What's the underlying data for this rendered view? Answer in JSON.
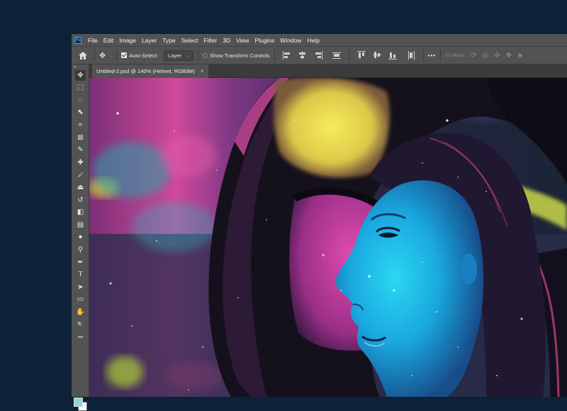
{
  "app": {
    "logo_text": "Ps"
  },
  "menu": [
    "File",
    "Edit",
    "Image",
    "Layer",
    "Type",
    "Select",
    "Filter",
    "3D",
    "View",
    "Plugins",
    "Window",
    "Help"
  ],
  "options_bar": {
    "auto_select_label": "Auto-Select:",
    "auto_select_checked": true,
    "auto_select_target": "Layer",
    "show_transform_label": "Show Transform Controls",
    "more_label": "•••",
    "mode_3d_label": "3D Mode:"
  },
  "document_tab": {
    "title": "Untitled-2.psd @ 140% (Helmet, RGB/8#)",
    "close": "×"
  },
  "toolbar": {
    "collapse": "»",
    "tools": [
      {
        "name": "move-tool",
        "glyph": "✥",
        "active": true
      },
      {
        "name": "marquee-tool",
        "glyph": "⬚"
      },
      {
        "name": "lasso-tool",
        "glyph": "◌"
      },
      {
        "name": "object-select-tool",
        "glyph": "⬉"
      },
      {
        "name": "crop-tool",
        "glyph": "⌗"
      },
      {
        "name": "frame-tool",
        "glyph": "⊠"
      },
      {
        "name": "eyedropper-tool",
        "glyph": "✎"
      },
      {
        "name": "healing-brush-tool",
        "glyph": "✚"
      },
      {
        "name": "brush-tool",
        "glyph": "🖌"
      },
      {
        "name": "clone-stamp-tool",
        "glyph": "⏏"
      },
      {
        "name": "history-brush-tool",
        "glyph": "↺"
      },
      {
        "name": "eraser-tool",
        "glyph": "◧"
      },
      {
        "name": "gradient-tool",
        "glyph": "▤"
      },
      {
        "name": "blur-tool",
        "glyph": "●"
      },
      {
        "name": "dodge-tool",
        "glyph": "⚲"
      },
      {
        "name": "pen-tool",
        "glyph": "✒"
      },
      {
        "name": "type-tool",
        "glyph": "T"
      },
      {
        "name": "path-select-tool",
        "glyph": "➤"
      },
      {
        "name": "rectangle-tool",
        "glyph": "▭"
      },
      {
        "name": "hand-tool",
        "glyph": "✋"
      },
      {
        "name": "zoom-tool",
        "glyph": "🔍"
      },
      {
        "name": "edit-toolbar",
        "glyph": "•••"
      }
    ]
  },
  "colors": {
    "foreground": "#8fd6d2",
    "background": "#ffffff",
    "page_bg": "#0d2238",
    "ui_panel": "#535353"
  }
}
